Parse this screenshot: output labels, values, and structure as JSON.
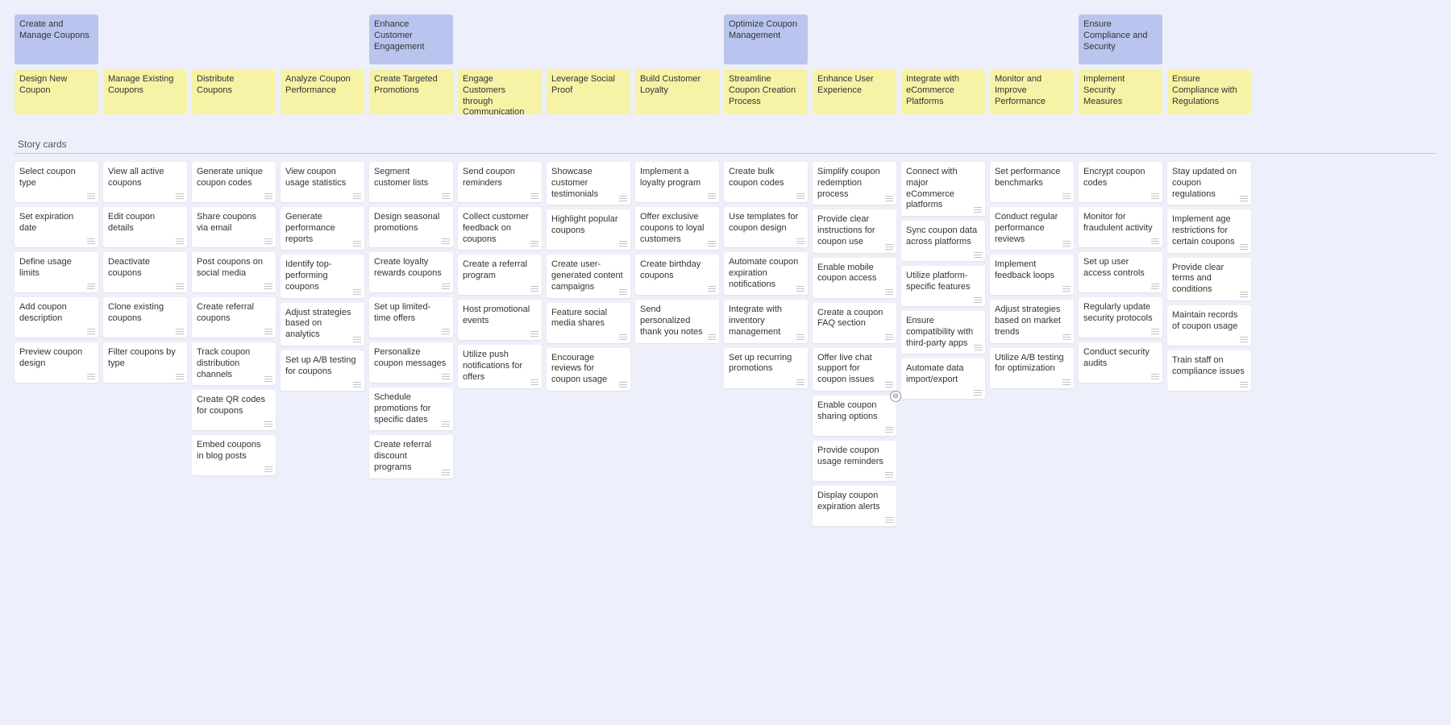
{
  "section_label": "Story cards",
  "columns": [
    {
      "epic": "Create and Manage Coupons",
      "feature": "Design New Coupon",
      "stories": [
        "Select coupon type",
        "Set expiration date",
        "Define usage limits",
        "Add coupon description",
        "Preview coupon design"
      ]
    },
    {
      "epic": "",
      "feature": "Manage Existing Coupons",
      "stories": [
        "View all active coupons",
        "Edit coupon details",
        "Deactivate coupons",
        "Clone existing coupons",
        "Filter coupons by type"
      ]
    },
    {
      "epic": "",
      "feature": "Distribute Coupons",
      "stories": [
        "Generate unique coupon codes",
        "Share coupons via email",
        "Post coupons on social media",
        "Create referral coupons",
        "Track coupon distribution channels",
        "Create QR codes for coupons",
        "Embed coupons in blog posts"
      ]
    },
    {
      "epic": "",
      "feature": "Analyze Coupon Performance",
      "stories": [
        "View coupon usage statistics",
        "Generate performance reports",
        "Identify top-performing coupons",
        "Adjust strategies based on analytics",
        "Set up A/B testing for coupons"
      ]
    },
    {
      "epic": "Enhance Customer Engagement",
      "feature": "Create Targeted Promotions",
      "stories": [
        "Segment customer lists",
        "Design seasonal promotions",
        "Create loyalty rewards coupons",
        "Set up limited-time offers",
        "Personalize coupon messages",
        "Schedule promotions for specific dates",
        "Create referral discount programs"
      ]
    },
    {
      "epic": "",
      "feature": "Engage Customers through Communication",
      "stories": [
        "Send coupon reminders",
        "Collect customer feedback on coupons",
        "Create a referral program",
        "Host promotional events",
        "Utilize push notifications for offers"
      ]
    },
    {
      "epic": "",
      "feature": "Leverage Social Proof",
      "stories": [
        "Showcase customer testimonials",
        "Highlight popular coupons",
        "Create user-generated content campaigns",
        "Feature social media shares",
        "Encourage reviews for coupon usage"
      ]
    },
    {
      "epic": "",
      "feature": "Build Customer Loyalty",
      "stories": [
        "Implement a loyalty program",
        "Offer exclusive coupons to loyal customers",
        "Create birthday coupons",
        "Send personalized thank you notes"
      ]
    },
    {
      "epic": "Optimize Coupon Management",
      "feature": "Streamline Coupon Creation Process",
      "stories": [
        "Create bulk coupon codes",
        "Use templates for coupon design",
        "Automate coupon expiration notifications",
        "Integrate with inventory management",
        "Set up recurring promotions"
      ]
    },
    {
      "epic": "",
      "feature": "Enhance User Experience",
      "stories": [
        "Simplify coupon redemption process",
        "Provide clear instructions for coupon use",
        "Enable mobile coupon access",
        "Create a coupon FAQ section",
        "Offer live chat support for coupon issues",
        "Enable coupon sharing options",
        "Provide coupon usage reminders",
        "Display coupon expiration alerts"
      ],
      "badge_at": 5
    },
    {
      "epic": "",
      "feature": "Integrate with eCommerce Platforms",
      "stories": [
        "Connect with major eCommerce platforms",
        "Sync coupon data across platforms",
        "Utilize platform-specific features",
        "Ensure compatibility with third-party apps",
        "Automate data import/export"
      ]
    },
    {
      "epic": "",
      "feature": "Monitor and Improve Performance",
      "stories": [
        "Set performance benchmarks",
        "Conduct regular performance reviews",
        "Implement feedback loops",
        "Adjust strategies based on market trends",
        "Utilize A/B testing for optimization"
      ]
    },
    {
      "epic": "Ensure Compliance and Security",
      "feature": "Implement Security Measures",
      "stories": [
        "Encrypt coupon codes",
        "Monitor for fraudulent activity",
        "Set up user access controls",
        "Regularly update security protocols",
        "Conduct security audits"
      ]
    },
    {
      "epic": "",
      "feature": "Ensure Compliance with Regulations",
      "stories": [
        "Stay updated on coupon regulations",
        "Implement age restrictions for certain coupons",
        "Provide clear terms and conditions",
        "Maintain records of coupon usage",
        "Train staff on compliance issues"
      ]
    }
  ]
}
